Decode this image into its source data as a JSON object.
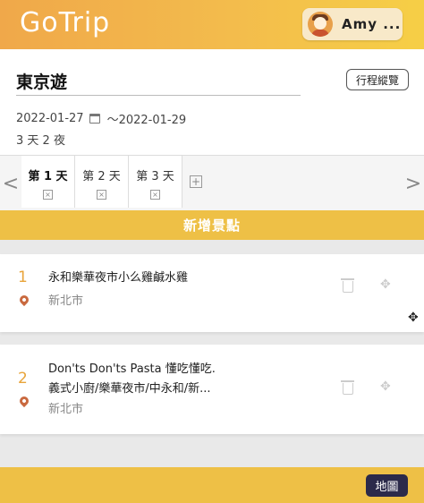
{
  "header": {
    "logo": "GoTrip",
    "user_name": "Amy ..."
  },
  "trip": {
    "title": "東京遊",
    "overview_button": "行程縱覽",
    "start_date": "2022-01-27",
    "end_date": "～2022-01-29",
    "duration": "3 天 2 夜"
  },
  "tabs": {
    "prev_arrow": "<",
    "next_arrow": ">",
    "items": [
      {
        "label": "第 1 天",
        "close": "×",
        "active": true
      },
      {
        "label": "第 2 天",
        "close": "×",
        "active": false
      },
      {
        "label": "第 3 天",
        "close": "×",
        "active": false
      }
    ],
    "add": "+"
  },
  "add_spot_label": "新增景點",
  "spots": [
    {
      "number": "1",
      "name_line1": "永和樂華夜市小么雞鹹水雞",
      "name_line2": "",
      "city": "新北市"
    },
    {
      "number": "2",
      "name_line1": "Don'ts Don'ts Pasta 懂吃懂吃.",
      "name_line2": "義式小廚/樂華夜市/中永和/新...",
      "city": "新北市"
    }
  ],
  "icons": {
    "trash": "trash-icon",
    "move": "move-icon",
    "calendar": "calendar-icon",
    "pin": "location-pin-icon"
  },
  "move_glyph": "✥",
  "cursor_glyph": "✥",
  "colors": {
    "brand_orange": "#f0a84a",
    "brand_yellow": "#eec046",
    "number": "#e8a43a",
    "map_button": "#2b2a4a"
  },
  "footer": {
    "map_button": "地圖"
  }
}
